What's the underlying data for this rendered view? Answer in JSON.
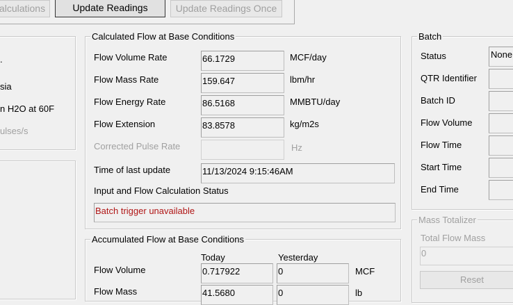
{
  "toolbar": {
    "calculations_label": "alculations",
    "update_readings_label": "Update Readings",
    "update_readings_once_label": "Update Readings Once"
  },
  "left_panel": {
    "line1": ".",
    "line2": "sia",
    "line3": "n H2O at 60F",
    "line4": "ulses/s"
  },
  "calculated_flow": {
    "title": "Calculated Flow at Base Conditions",
    "rows": [
      {
        "label": "Flow Volume Rate",
        "value": "66.1729",
        "unit": "MCF/day"
      },
      {
        "label": "Flow Mass Rate",
        "value": "159.647",
        "unit": "lbm/hr"
      },
      {
        "label": "Flow Energy Rate",
        "value": "86.5168",
        "unit": "MMBTU/day"
      },
      {
        "label": "Flow Extension",
        "value": "83.8578",
        "unit": "kg/m2s"
      },
      {
        "label": "Corrected Pulse Rate",
        "value": "",
        "unit": "Hz"
      }
    ],
    "time_label": "Time of last update",
    "time_value": "11/13/2024 9:15:46AM",
    "status_label": "Input and Flow Calculation Status",
    "status_value": "Batch trigger unavailable",
    "status_color": "#b01616"
  },
  "accumulated_flow": {
    "title": "Accumulated Flow at Base Conditions",
    "col_today": "Today",
    "col_yesterday": "Yesterday",
    "rows": [
      {
        "label": "Flow Volume",
        "today": "0.717922",
        "yesterday": "0",
        "unit": "MCF"
      },
      {
        "label": "Flow Mass",
        "today": "41.5680",
        "yesterday": "0",
        "unit": "lb"
      }
    ]
  },
  "batch": {
    "title": "Batch",
    "rows": [
      {
        "label": "Status",
        "value": "None"
      },
      {
        "label": "QTR Identifier",
        "value": ""
      },
      {
        "label": "Batch ID",
        "value": ""
      },
      {
        "label": "Flow Volume",
        "value": ""
      },
      {
        "label": "Flow Time",
        "value": ""
      },
      {
        "label": "Start Time",
        "value": ""
      },
      {
        "label": "End Time",
        "value": ""
      }
    ]
  },
  "mass_totalizer": {
    "title": "Mass Totalizer",
    "total_label": "Total Flow Mass",
    "total_value": "0",
    "reset_label": "Reset"
  }
}
